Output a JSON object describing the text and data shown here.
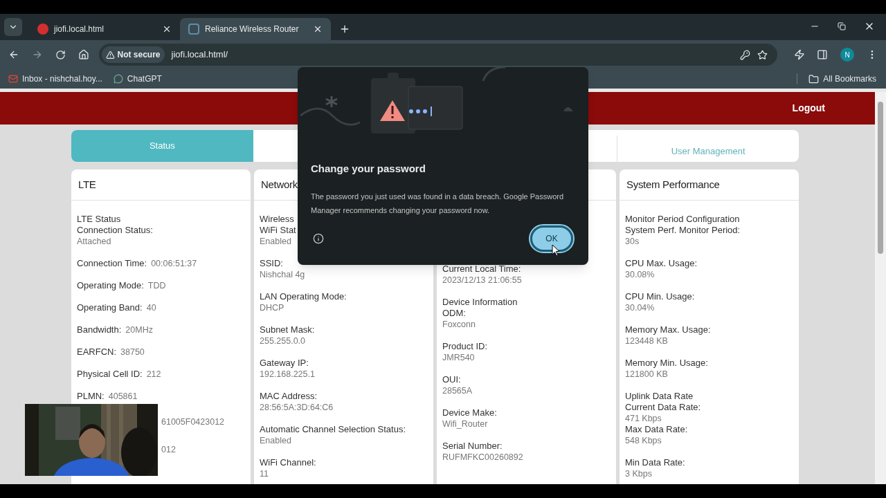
{
  "browser": {
    "tabs": [
      {
        "title": "jiofi.local.html",
        "selected": false
      },
      {
        "title": "Reliance Wireless Router",
        "selected": true
      }
    ],
    "security_chip": "Not secure",
    "url": "jiofi.local.html/",
    "profile_initial": "N",
    "bookmarks": [
      {
        "label": "Inbox - nishchal.hoy..."
      },
      {
        "label": "ChatGPT"
      }
    ],
    "all_bookmarks": "All Bookmarks"
  },
  "page": {
    "logout": "Logout",
    "tabs": [
      {
        "label": "Status",
        "selected": true
      },
      {
        "label": "User Management",
        "selected": false
      }
    ],
    "cards": [
      {
        "title": "LTE",
        "groups": [
          {
            "heading": "LTE Status",
            "fields": [
              {
                "kind": "stacked",
                "label": "Connection Status:",
                "value": "Attached"
              }
            ]
          },
          {
            "fields": [
              {
                "kind": "inline",
                "label": "Connection Time:",
                "value": "00:06:51:37"
              }
            ]
          },
          {
            "fields": [
              {
                "kind": "inline",
                "label": "Operating Mode:",
                "value": "TDD"
              }
            ]
          },
          {
            "fields": [
              {
                "kind": "inline",
                "label": "Operating Band:",
                "value": "40"
              }
            ]
          },
          {
            "fields": [
              {
                "kind": "inline",
                "label": "Bandwidth:",
                "value": "20MHz"
              }
            ]
          },
          {
            "fields": [
              {
                "kind": "inline",
                "label": "EARFCN:",
                "value": "38750"
              }
            ]
          },
          {
            "fields": [
              {
                "kind": "inline",
                "label": "Physical Cell ID:",
                "value": "212"
              }
            ]
          },
          {
            "fields": [
              {
                "kind": "inline",
                "label": "PLMN:",
                "value": "405861"
              }
            ]
          },
          {
            "fields": [
              {
                "kind": "fragment",
                "value": "61005F0423012"
              }
            ]
          },
          {
            "fields": [
              {
                "kind": "fragment",
                "value": "012"
              }
            ]
          }
        ]
      },
      {
        "title": "Network",
        "groups": [
          {
            "heading": "Wireless",
            "fields": [
              {
                "kind": "stacked",
                "label": "WiFi Stat",
                "value": "Enabled"
              }
            ]
          },
          {
            "fields": [
              {
                "kind": "stacked",
                "label": "SSID:",
                "value": "Nishchal 4g"
              }
            ]
          },
          {
            "fields": [
              {
                "kind": "stacked",
                "label": "LAN Operating Mode:",
                "value": "DHCP"
              }
            ]
          },
          {
            "fields": [
              {
                "kind": "stacked",
                "label": "Subnet Mask:",
                "value": "255.255.0.0"
              }
            ]
          },
          {
            "fields": [
              {
                "kind": "stacked",
                "label": "Gateway IP:",
                "value": "192.168.225.1"
              }
            ]
          },
          {
            "fields": [
              {
                "kind": "stacked",
                "label": "MAC Address:",
                "value": "28:56:5A:3D:64:C6"
              }
            ]
          },
          {
            "fields": [
              {
                "kind": "stacked",
                "label": "Automatic Channel Selection Status:",
                "value": "Enabled"
              }
            ]
          },
          {
            "fields": [
              {
                "kind": "stacked",
                "label": "WiFi Channel:",
                "value": "11"
              }
            ]
          }
        ]
      },
      {
        "groups": [
          {
            "fields": [
              {
                "kind": "stacked",
                "label": "Current Local Time:",
                "value": "2023/12/13 21:06:55"
              }
            ]
          },
          {
            "heading": "Device Information",
            "fields": [
              {
                "kind": "stacked",
                "label": "ODM:",
                "value": "Foxconn"
              }
            ]
          },
          {
            "fields": [
              {
                "kind": "stacked",
                "label": "Product ID:",
                "value": "JMR540"
              }
            ]
          },
          {
            "fields": [
              {
                "kind": "stacked",
                "label": "OUI:",
                "value": "28565A"
              }
            ]
          },
          {
            "fields": [
              {
                "kind": "stacked",
                "label": "Device Make:",
                "value": "Wifi_Router"
              }
            ]
          },
          {
            "fields": [
              {
                "kind": "stacked",
                "label": "Serial Number:",
                "value": "RUFMFKC00260892"
              }
            ]
          }
        ]
      },
      {
        "title": "System Performance",
        "groups": [
          {
            "heading": "Monitor Period Configuration",
            "fields": [
              {
                "kind": "stacked",
                "label": "System Perf. Monitor Period:",
                "value": "30s"
              }
            ]
          },
          {
            "fields": [
              {
                "kind": "stacked",
                "label": "CPU Max. Usage:",
                "value": "30.08%"
              }
            ]
          },
          {
            "fields": [
              {
                "kind": "stacked",
                "label": "CPU Min. Usage:",
                "value": "30.04%"
              }
            ]
          },
          {
            "fields": [
              {
                "kind": "stacked",
                "label": "Memory Max. Usage:",
                "value": "123448 KB"
              }
            ]
          },
          {
            "fields": [
              {
                "kind": "stacked",
                "label": "Memory Min. Usage:",
                "value": "121800 KB"
              }
            ]
          },
          {
            "heading": "Uplink Data Rate",
            "fields": [
              {
                "kind": "stacked",
                "label": "Current Data Rate:",
                "value": "471 Kbps"
              },
              {
                "kind": "stacked",
                "label": "Max Data Rate:",
                "value": "548 Kbps"
              }
            ]
          },
          {
            "fields": [
              {
                "kind": "stacked",
                "label": "Min Data Rate:",
                "value": "3 Kbps"
              }
            ]
          }
        ]
      }
    ]
  },
  "dialog": {
    "title": "Change your password",
    "body": "The password you just used was found in a data breach. Google Password Manager recommends changing your password now.",
    "ok": "OK"
  }
}
